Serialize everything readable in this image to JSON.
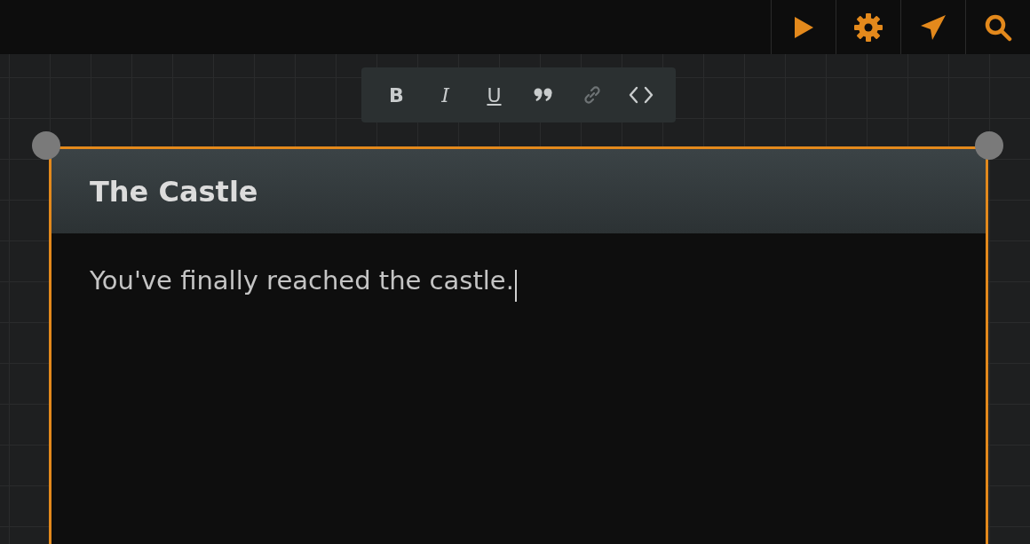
{
  "toolbar": {
    "buttons": [
      {
        "kind": "play"
      },
      {
        "kind": "settings"
      },
      {
        "kind": "send"
      },
      {
        "kind": "search"
      }
    ]
  },
  "format_toolbar": {
    "tools": [
      {
        "kind": "bold",
        "label": "B",
        "disabled": false
      },
      {
        "kind": "italic",
        "label": "I",
        "disabled": false
      },
      {
        "kind": "underline",
        "label": "U",
        "disabled": false
      },
      {
        "kind": "quote",
        "disabled": false
      },
      {
        "kind": "link",
        "disabled": true
      },
      {
        "kind": "code",
        "disabled": false
      }
    ]
  },
  "card": {
    "selected": true,
    "title": "The Castle",
    "body": "You've finally reached the castle.",
    "focused": true
  }
}
